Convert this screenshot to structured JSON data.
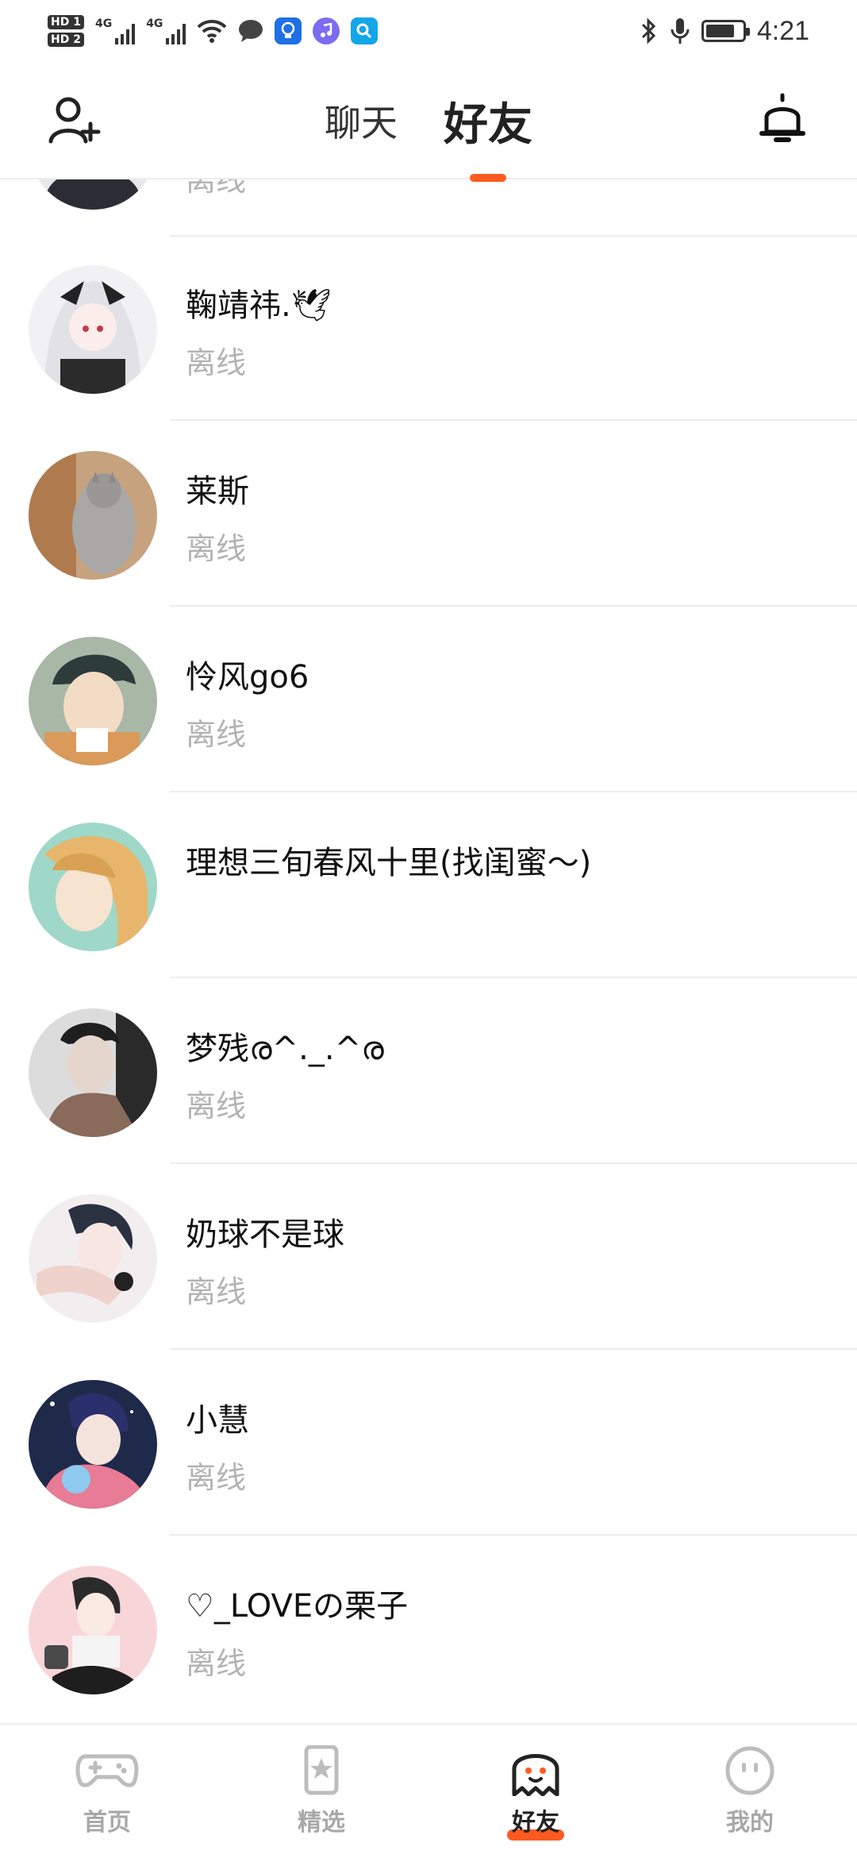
{
  "status_bar": {
    "time": "4:21",
    "sim1": "HD 1",
    "sim2": "HD 2",
    "network_tag": "4G",
    "battery_level": 0.8
  },
  "header": {
    "tabs": [
      {
        "label": "聊天"
      },
      {
        "label": "好友"
      }
    ],
    "active_tab": "好友"
  },
  "friends": [
    {
      "name": "",
      "status": "离线"
    },
    {
      "name": "鞠靖祎.🕊",
      "status": "离线"
    },
    {
      "name": "莱斯",
      "status": "离线"
    },
    {
      "name": "怜风go6",
      "status": "离线"
    },
    {
      "name": "理想三旬春风十里(找闺蜜～)",
      "status": ""
    },
    {
      "name": "梦残ര^._.^ര",
      "status": "离线"
    },
    {
      "name": "奶球不是球",
      "status": "离线"
    },
    {
      "name": "小慧",
      "status": "离线"
    },
    {
      "name": "♡_LOVEの栗子",
      "status": "离线"
    }
  ],
  "bottom_nav": {
    "items": [
      {
        "label": "首页",
        "icon": "gamepad-icon"
      },
      {
        "label": "精选",
        "icon": "star-bookmark-icon"
      },
      {
        "label": "好友",
        "icon": "ghost-icon"
      },
      {
        "label": "我的",
        "icon": "face-icon"
      }
    ],
    "active": "好友"
  },
  "colors": {
    "accent": "#ff5a1f",
    "offline_text": "#b3b3b3",
    "divider": "#ececec"
  }
}
